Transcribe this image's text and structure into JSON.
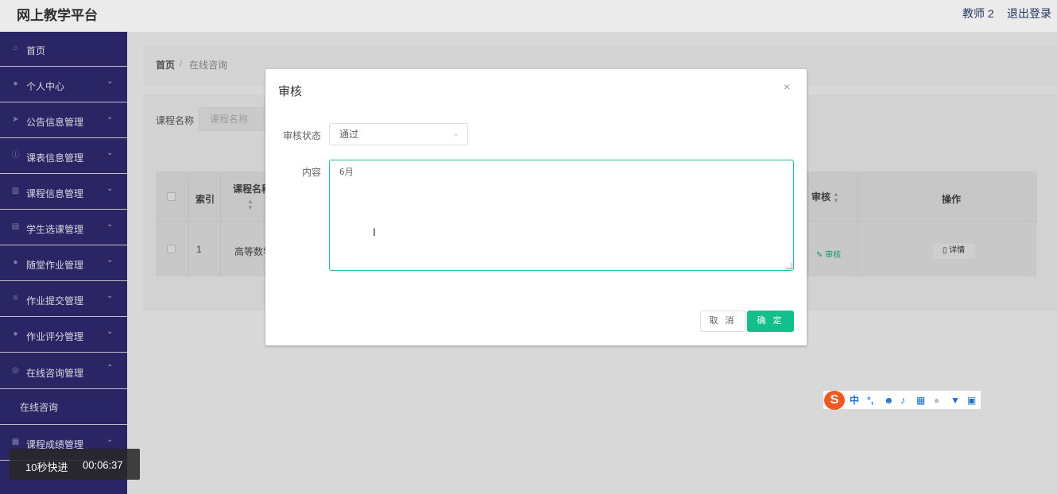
{
  "header": {
    "brand": "网上教学平台",
    "user": "教师 2",
    "logout": "退出登录"
  },
  "sidebar": {
    "items": [
      {
        "label": "首页",
        "icon": "home-icon",
        "arrow": ""
      },
      {
        "label": "个人中心",
        "icon": "user-icon",
        "arrow": "⌄"
      },
      {
        "label": "公告信息管理",
        "icon": "send-icon",
        "arrow": "⌄"
      },
      {
        "label": "课表信息管理",
        "icon": "info-icon",
        "arrow": "⌄"
      },
      {
        "label": "课程信息管理",
        "icon": "bar-chart-icon",
        "arrow": "⌄"
      },
      {
        "label": "学生选课管理",
        "icon": "briefcase-icon",
        "arrow": "⌄"
      },
      {
        "label": "随堂作业管理",
        "icon": "user-icon",
        "arrow": "⌄"
      },
      {
        "label": "作业提交管理",
        "icon": "menu-icon",
        "arrow": "⌄"
      },
      {
        "label": "作业评分管理",
        "icon": "user-icon",
        "arrow": "⌄"
      },
      {
        "label": "在线咨询管理",
        "icon": "globe-icon",
        "arrow": "⌃"
      },
      {
        "label": "课程成绩管理",
        "icon": "document-icon",
        "arrow": "⌄"
      }
    ],
    "subitem": "在线咨询"
  },
  "breadcrumb": {
    "home": "首页",
    "separator": "/",
    "current": "在线咨询"
  },
  "search": {
    "label": "课程名称",
    "placeholder": "课程名称"
  },
  "table": {
    "headers": {
      "index": "索引",
      "course_name": "课程名称",
      "review": "审核",
      "actions": "操作"
    },
    "rows": [
      {
        "index": "1",
        "course_name": "高等数学",
        "review_action": "审核",
        "detail_action": "详情"
      }
    ]
  },
  "dialog": {
    "title": "审核",
    "close": "×",
    "status_label": "审核状态",
    "status_value": "通过",
    "content_label": "内容",
    "content_value": "6月",
    "cancel": "取 消",
    "confirm": "确 定"
  },
  "ime": {
    "logo": "S",
    "mode": "中",
    "punct": "°,",
    "icons": [
      "emoji-icon",
      "mic-icon",
      "keyboard-icon",
      "user-icon",
      "shirt-icon",
      "grid-icon"
    ]
  },
  "toast": {
    "label": "10秒快进",
    "time": "00:06:37"
  },
  "colors": {
    "sidebar_bg": "#2e2a6e",
    "accent": "#13c08c",
    "textarea_border": "#1fc2a0",
    "ime_logo": "#ef5a24"
  }
}
